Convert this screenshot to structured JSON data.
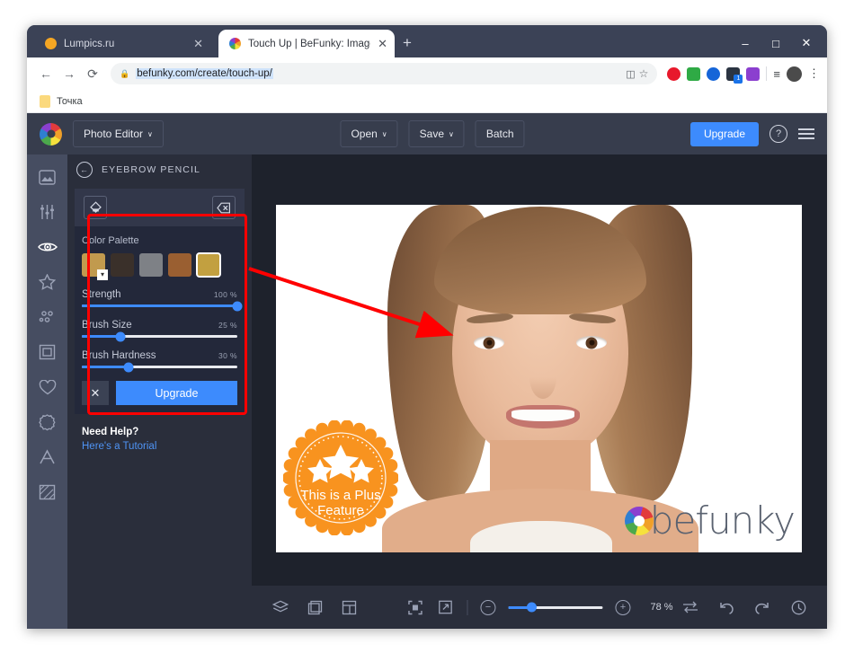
{
  "browser": {
    "tabs": [
      {
        "title": "Lumpics.ru",
        "favicon": "orange-circle-icon",
        "active": false
      },
      {
        "title": "Touch Up | BeFunky: Image Reto",
        "favicon": "befunky-icon",
        "active": true
      }
    ],
    "new_tab_label": "+",
    "window_controls": {
      "minimize": "–",
      "maximize": "□",
      "close": "✕"
    },
    "nav": {
      "back": "←",
      "forward": "→",
      "reload": "⟳"
    },
    "omnibox": {
      "lock_icon": "lock-icon",
      "url": "befunky.com/create/touch-up/"
    },
    "omnibox_icons": [
      "cast-icon",
      "bookmark-star-icon"
    ],
    "extensions": [
      {
        "name": "opera-extension-icon",
        "color": "#e8192c"
      },
      {
        "name": "music-extension-icon",
        "color": "#2faa45"
      },
      {
        "name": "globe-extension-icon",
        "color": "#1565d8"
      },
      {
        "name": "package-extension-icon",
        "color": "#2b3442",
        "badge": "1"
      },
      {
        "name": "purple-extension-icon",
        "color": "#8b3fcf"
      }
    ],
    "toolbar_end": [
      "reading-list-icon",
      "profile-avatar",
      "chrome-menu-icon"
    ],
    "bookmarks": [
      {
        "label": "Точка",
        "icon": "bookmark-page-icon"
      }
    ]
  },
  "app": {
    "logo": "befunky-aperture-logo",
    "product_menu": "Photo Editor",
    "menus": [
      "Open",
      "Save",
      "Batch"
    ],
    "open_label": "Open",
    "save_label": "Save",
    "batch_label": "Batch",
    "upgrade_label": "Upgrade",
    "help_icon": "question-mark-icon",
    "menu_icon": "hamburger-menu-icon",
    "caret": "∨"
  },
  "toolrail": [
    {
      "name": "sidebar-item-image",
      "icon": "image-icon",
      "active": false
    },
    {
      "name": "sidebar-item-edit",
      "icon": "sliders-icon",
      "active": false
    },
    {
      "name": "sidebar-item-touchup",
      "icon": "eye-icon",
      "active": true
    },
    {
      "name": "sidebar-item-effects",
      "icon": "star-icon",
      "active": false
    },
    {
      "name": "sidebar-item-artsy",
      "icon": "dots-icon",
      "active": false
    },
    {
      "name": "sidebar-item-frames",
      "icon": "frame-icon",
      "active": false
    },
    {
      "name": "sidebar-item-overlays",
      "icon": "heart-icon",
      "active": false
    },
    {
      "name": "sidebar-item-graphics",
      "icon": "badge-icon",
      "active": false
    },
    {
      "name": "sidebar-item-text",
      "icon": "text-a-icon",
      "active": false
    },
    {
      "name": "sidebar-item-textures",
      "icon": "texture-icon",
      "active": false
    }
  ],
  "panel": {
    "back_icon": "back-arrow-icon",
    "title": "EYEBROW PENCIL",
    "tools": [
      {
        "name": "brush-tool-icon",
        "icon": "paint-brush-icon"
      },
      {
        "name": "eraser-tool-icon",
        "icon": "eraser-icon"
      }
    ],
    "color_palette_label": "Color Palette",
    "swatches": [
      {
        "color": "#c19a4e",
        "selected": false,
        "has_dropdown": true
      },
      {
        "color": "#3a302a",
        "selected": false,
        "has_dropdown": false
      },
      {
        "color": "#7e8186",
        "selected": false,
        "has_dropdown": false
      },
      {
        "color": "#9a5f31",
        "selected": false,
        "has_dropdown": false
      },
      {
        "color": "#c2a040",
        "selected": true,
        "has_dropdown": false
      }
    ],
    "sliders": [
      {
        "label": "Strength",
        "value": "100 %",
        "percent": 100
      },
      {
        "label": "Brush Size",
        "value": "25 %",
        "percent": 25
      },
      {
        "label": "Brush Hardness",
        "value": "30 %",
        "percent": 30
      }
    ],
    "cancel_label": "✕",
    "upgrade_label": "Upgrade",
    "help_title": "Need Help?",
    "help_link": "Here's a Tutorial"
  },
  "canvas": {
    "plus_badge": {
      "line1": "This is a Plus",
      "line2": "Feature",
      "color": "#f8931f",
      "stars": 3
    },
    "watermark": "befunky"
  },
  "bottombar": {
    "left_icons": [
      "layers-icon",
      "crop-icon",
      "template-icon"
    ],
    "view_icons": [
      "fit-screen-icon",
      "fullscreen-icon"
    ],
    "zoom_out": "−",
    "zoom_in": "+",
    "zoom_percent": "78 %",
    "zoom_slider_percent": 25,
    "right_icons": [
      "compare-icon",
      "undo-icon",
      "redo-icon",
      "history-icon"
    ]
  },
  "colors": {
    "accent_blue": "#3d8bfd",
    "annotation_red": "#ff0000",
    "plus_orange": "#f8931f"
  }
}
